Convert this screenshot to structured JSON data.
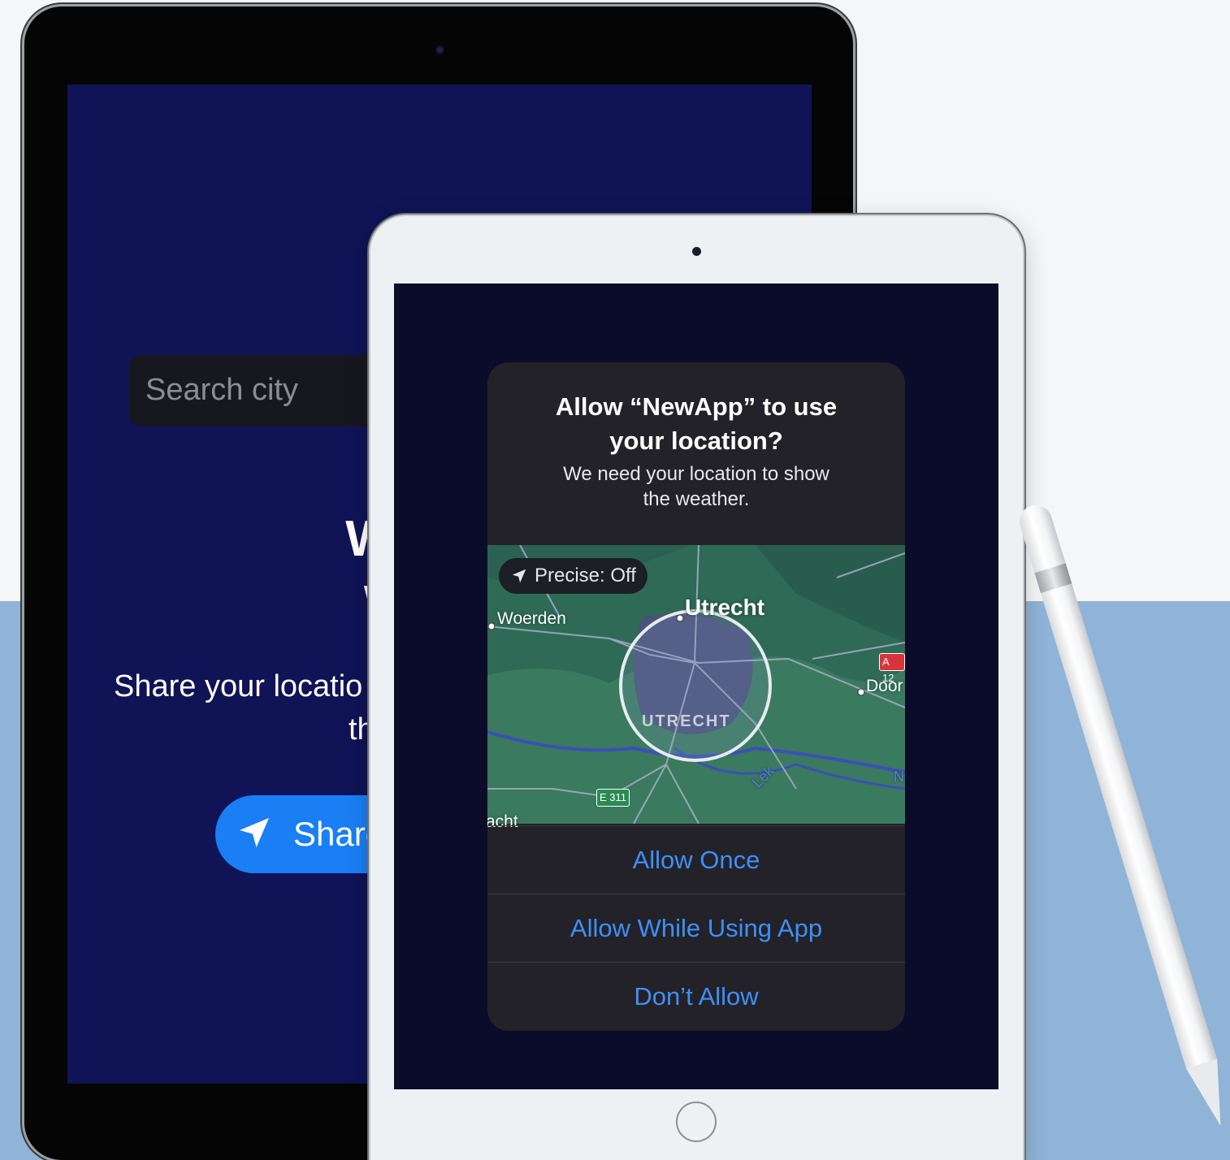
{
  "back_device": {
    "search_placeholder": "Search city",
    "welcome_line1": "Welc",
    "welcome_line2": "Wea",
    "share_line1": "Share your locatio",
    "share_line2": "th",
    "share_button_label": "Share"
  },
  "location_alert": {
    "title_line1": "Allow “NewApp” to use",
    "title_line2": "your location?",
    "message_line1": "We need your location to show",
    "message_line2": "the weather.",
    "precise_toggle": "Precise: Off",
    "map": {
      "labels": {
        "woerden": "Woerden",
        "utrecht": "Utrecht",
        "district": "UTRECHT",
        "doorn": "Door",
        "acht": "acht",
        "lek": "Lek",
        "n": "N"
      },
      "road_badges": {
        "a12": "A 12",
        "e311": "E 311"
      }
    },
    "buttons": {
      "allow_once": "Allow Once",
      "allow_while_using": "Allow While Using App",
      "dont_allow": "Don’t Allow"
    }
  },
  "colors": {
    "accent_blue": "#3f8ff7",
    "share_button": "#1a7ef5",
    "back_screen": "#101355",
    "alert_bg": "#222228",
    "map_green": "#2f6b58",
    "page_blue": "#8fb4d7"
  },
  "icons": [
    "location-arrow-icon",
    "precise-location-icon",
    "camera-icon",
    "home-button-icon"
  ]
}
